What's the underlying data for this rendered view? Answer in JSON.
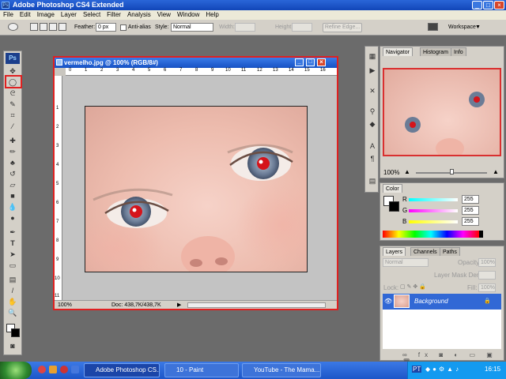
{
  "app": {
    "title": "Adobe Photoshop CS4 Extended",
    "logo": "Ps"
  },
  "menu": [
    "File",
    "Edit",
    "Image",
    "Layer",
    "Select",
    "Filter",
    "Analysis",
    "View",
    "Window",
    "Help"
  ],
  "options": {
    "feather_label": "Feather:",
    "feather_value": "0 px",
    "antialias_label": "Anti-alias",
    "style_label": "Style:",
    "style_value": "Normal",
    "width_label": "Width:",
    "height_label": "Height:",
    "refine_edge": "Refine Edge...",
    "workspace": "Workspace"
  },
  "document": {
    "title": "vermelho.jpg @ 100% (RGB/8#)",
    "zoom": "100%",
    "doc_info": "Doc: 438,7K/438,7K",
    "ruler_h": [
      "0",
      "1",
      "2",
      "3",
      "4",
      "5",
      "6",
      "7",
      "8",
      "9",
      "10",
      "11",
      "12",
      "13",
      "14",
      "15",
      "16"
    ],
    "ruler_v": [
      "1",
      "2",
      "3",
      "4",
      "5",
      "6",
      "7",
      "8",
      "9",
      "10",
      "11"
    ]
  },
  "navigator": {
    "tabs": [
      "Navigator",
      "Histogram",
      "Info"
    ],
    "zoom": "100%"
  },
  "color": {
    "tab": "Color",
    "r_label": "R",
    "g_label": "G",
    "b_label": "B",
    "r": "255",
    "g": "255",
    "b": "255"
  },
  "layers": {
    "tabs": [
      "Layers",
      "Channels",
      "Paths"
    ],
    "blend_mode": "Normal",
    "opacity_label": "Opacity:",
    "opacity_value": "100%",
    "mask_density_label": "Layer Mask Density:",
    "lock_label": "Lock:",
    "fill_label": "Fill:",
    "fill_value": "100%",
    "layer_name": "Background"
  },
  "taskbar": {
    "items": [
      "Adobe Photoshop CS...",
      "10 - Paint",
      "YouTube - The Mama..."
    ],
    "lang": "PT",
    "clock": "16:15"
  },
  "colors": {
    "highlight": "#e02020",
    "titlebar": "#1c56cf",
    "layer_selected": "#3168d5"
  }
}
